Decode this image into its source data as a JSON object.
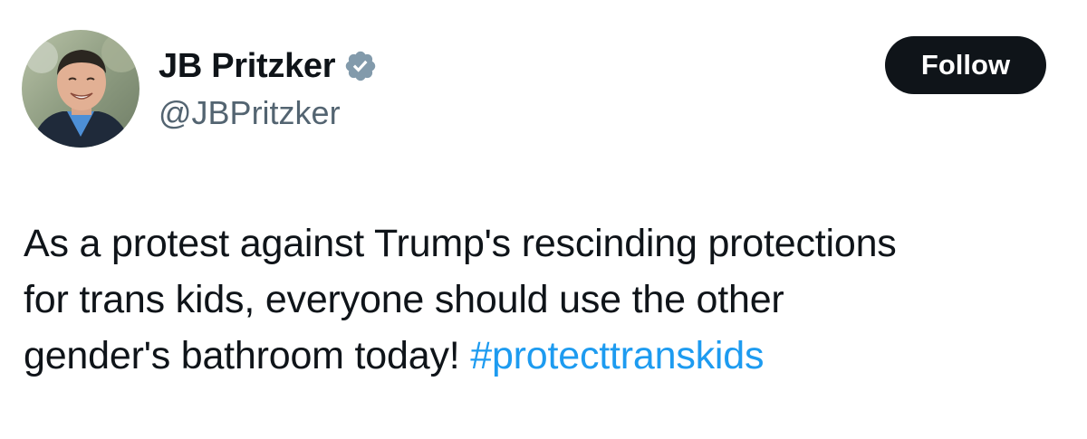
{
  "author": {
    "display_name": "JB Pritzker",
    "handle": "@JBPritzker",
    "avatar_icon": "profile-photo",
    "verified_icon": "verified-badge-icon",
    "verified_color": "#829aab"
  },
  "follow_button": {
    "label": "Follow",
    "bg_color": "#0f1419",
    "text_color": "#ffffff"
  },
  "tweet": {
    "line1": "As a protest against Trump's rescinding protections",
    "line2": "for trans kids, everyone should use the other",
    "line3_text": "gender's bathroom today!",
    "hashtag": "#protecttranskids",
    "hashtag_color": "#1d9bf0"
  }
}
